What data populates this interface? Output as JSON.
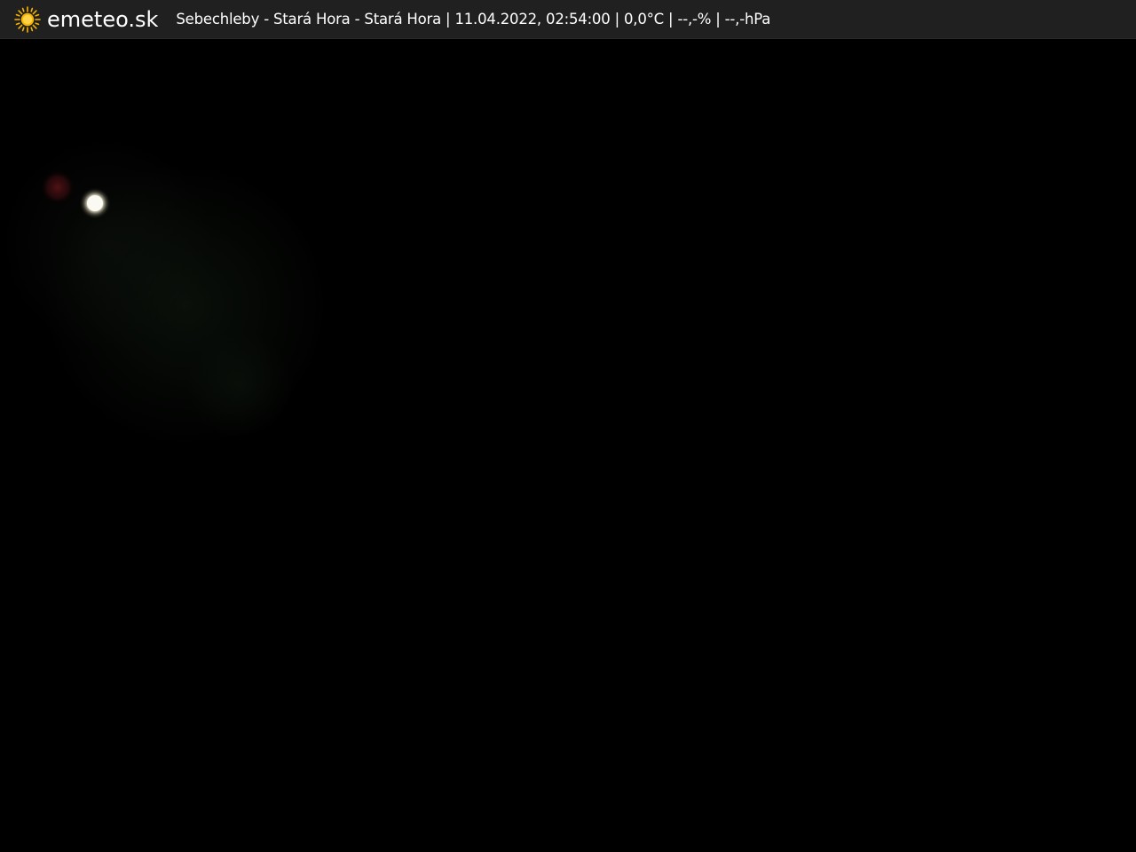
{
  "header": {
    "brand": "emeteo.sk",
    "logo_icon": "sun-icon",
    "status": "Sebechleby - Stará Hora - Stará Hora | 11.04.2022, 02:54:00 | 0,0°C | --,-% | --,-hPa"
  },
  "colors": {
    "header_bg": "#202020",
    "sun": "#f5b301",
    "image_bg": "#000000"
  }
}
